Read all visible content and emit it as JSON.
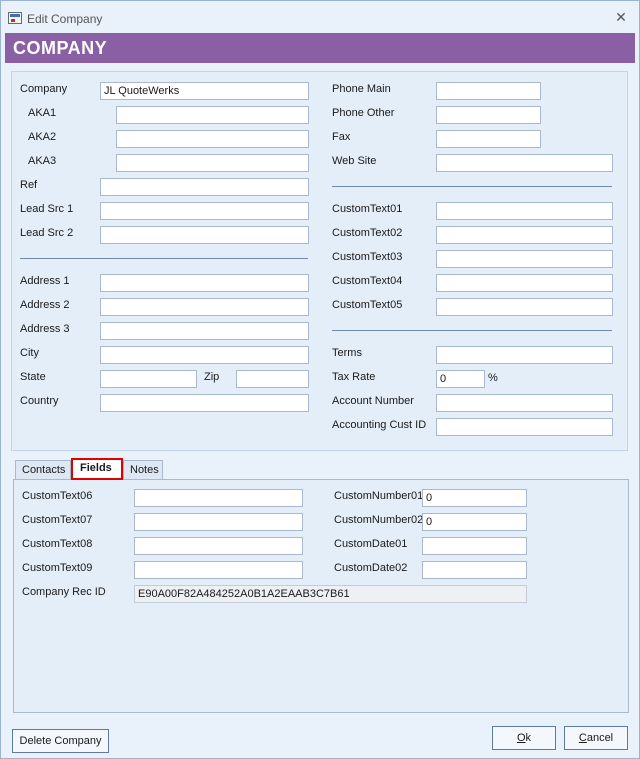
{
  "window": {
    "title": "Edit Company",
    "close_glyph": "✕"
  },
  "banner": {
    "title": "COMPANY"
  },
  "left": {
    "company": {
      "label": "Company",
      "value": "JL QuoteWerks"
    },
    "aka1": {
      "label": "AKA1",
      "value": ""
    },
    "aka2": {
      "label": "AKA2",
      "value": ""
    },
    "aka3": {
      "label": "AKA3",
      "value": ""
    },
    "ref": {
      "label": "Ref",
      "value": ""
    },
    "lead_src_1": {
      "label": "Lead Src 1",
      "value": ""
    },
    "lead_src_2": {
      "label": "Lead Src 2",
      "value": ""
    },
    "address1": {
      "label": "Address 1",
      "value": ""
    },
    "address2": {
      "label": "Address 2",
      "value": ""
    },
    "address3": {
      "label": "Address 3",
      "value": ""
    },
    "city": {
      "label": "City",
      "value": ""
    },
    "state": {
      "label": "State",
      "value": ""
    },
    "zip": {
      "label": "Zip",
      "value": ""
    },
    "country": {
      "label": "Country",
      "value": ""
    }
  },
  "right": {
    "phone_main": {
      "label": "Phone Main",
      "value": ""
    },
    "phone_other": {
      "label": "Phone Other",
      "value": ""
    },
    "fax": {
      "label": "Fax",
      "value": ""
    },
    "web_site": {
      "label": "Web Site",
      "value": ""
    },
    "custom_text01": {
      "label": "CustomText01",
      "value": ""
    },
    "custom_text02": {
      "label": "CustomText02",
      "value": ""
    },
    "custom_text03": {
      "label": "CustomText03",
      "value": ""
    },
    "custom_text04": {
      "label": "CustomText04",
      "value": ""
    },
    "custom_text05": {
      "label": "CustomText05",
      "value": ""
    },
    "terms": {
      "label": "Terms",
      "value": ""
    },
    "tax_rate": {
      "label": "Tax Rate",
      "value": "0",
      "unit": "%"
    },
    "account_number": {
      "label": "Account Number",
      "value": ""
    },
    "accounting_cust_id": {
      "label": "Accounting Cust ID",
      "value": ""
    }
  },
  "tabs": [
    {
      "label": "Contacts",
      "active": false
    },
    {
      "label": "Fields",
      "active": true
    },
    {
      "label": "Notes",
      "active": false
    }
  ],
  "fields": {
    "custom_text06": {
      "label": "CustomText06",
      "value": ""
    },
    "custom_text07": {
      "label": "CustomText07",
      "value": ""
    },
    "custom_text08": {
      "label": "CustomText08",
      "value": ""
    },
    "custom_text09": {
      "label": "CustomText09",
      "value": ""
    },
    "custom_number01": {
      "label": "CustomNumber01",
      "value": "0"
    },
    "custom_number02": {
      "label": "CustomNumber02",
      "value": "0"
    },
    "custom_date01": {
      "label": "CustomDate01",
      "value": ""
    },
    "custom_date02": {
      "label": "CustomDate02",
      "value": ""
    },
    "company_rec_id": {
      "label": "Company Rec ID",
      "value": "E90A00F82A484252A0B1A2EAAB3C7B61"
    }
  },
  "buttons": {
    "delete": "Delete Company",
    "ok_first": "O",
    "ok_rest": "k",
    "cancel_first": "C",
    "cancel_rest": "ancel"
  },
  "colors": {
    "banner": "#8a5fa3",
    "window_bg": "#e9f1fb",
    "active_tab_outline": "#e00000"
  }
}
